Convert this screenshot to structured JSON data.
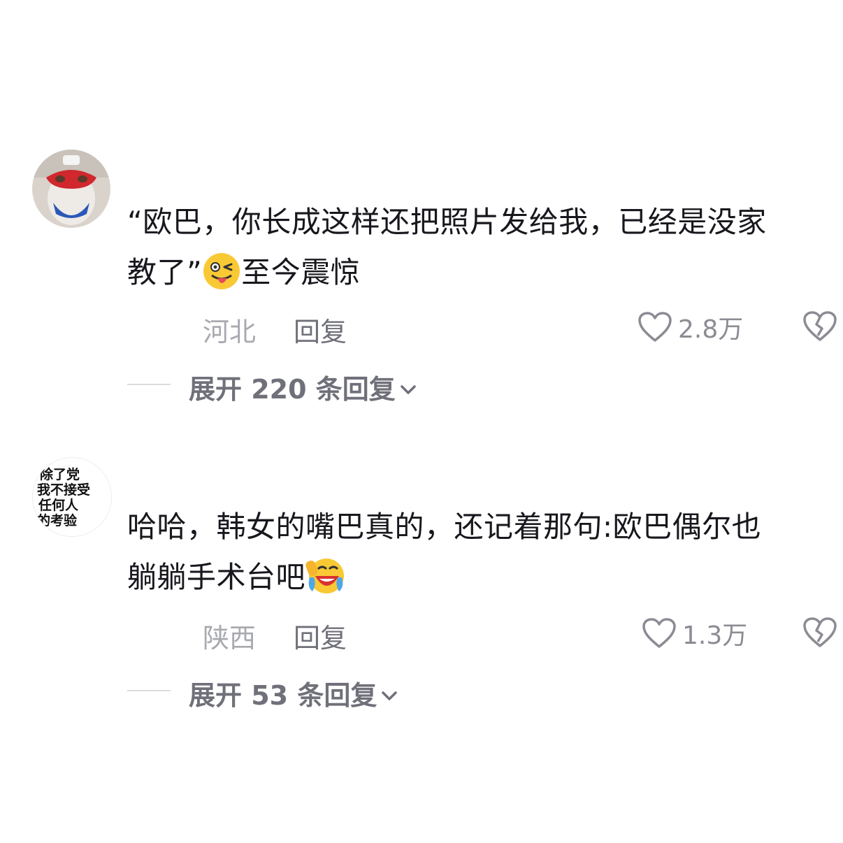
{
  "comments": [
    {
      "avatar": "masked-cat-avatar",
      "text_line1": "“欧巴，你长成这样还把照片发给我，已经是没家",
      "text_line2_before": "教了”",
      "emoji": "winking-tongue-emoji",
      "text_line2_after": "至今震惊",
      "location": "河北",
      "reply_label": "回复",
      "like_count": "2.8万",
      "expand_label": "展开 220 条回复"
    },
    {
      "avatar": "text-poster-avatar",
      "avatar_text": [
        "除了党",
        "我不接受",
        "任何人",
        "的考验"
      ],
      "text_line1": "哈哈，韩女的嘴巴真的，还记着那句:欧巴偶尔也",
      "text_line2_before": "躺躺手术台吧",
      "emoji": "laughing-crying-emoji",
      "location": "陕西",
      "reply_label": "回复",
      "like_count": "1.3万",
      "expand_label": "展开 53 条回复"
    }
  ],
  "icons": [
    "heart-icon",
    "broken-heart-icon",
    "chevron-down-icon"
  ],
  "colors": {
    "text": "#17171d",
    "muted": "#a9aab0",
    "secondary": "#6f7079"
  }
}
